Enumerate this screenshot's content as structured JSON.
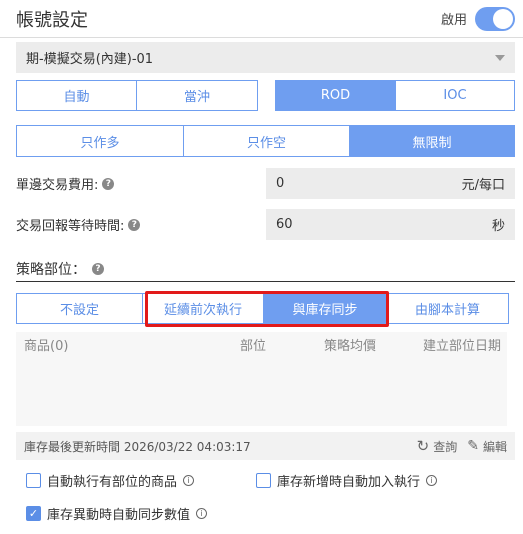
{
  "header": {
    "title": "帳號設定",
    "enable_label": "啟用",
    "enabled": true
  },
  "account": {
    "selected": "期-模擬交易(內建)-01"
  },
  "order_mode": {
    "group1": [
      {
        "label": "自動",
        "active": false
      },
      {
        "label": "當沖",
        "active": false
      }
    ],
    "group2": [
      {
        "label": "ROD",
        "active": true
      },
      {
        "label": "IOC",
        "active": false
      }
    ]
  },
  "direction": [
    {
      "label": "只作多",
      "active": false
    },
    {
      "label": "只作空",
      "active": false
    },
    {
      "label": "無限制",
      "active": true
    }
  ],
  "fee": {
    "label": "單邊交易費用:",
    "value": "0",
    "unit": "元/每口"
  },
  "wait": {
    "label": "交易回報等待時間:",
    "value": "60",
    "unit": "秒"
  },
  "strategy": {
    "title": "策略部位：",
    "tabs": [
      {
        "label": "不設定",
        "active": false
      },
      {
        "label": "延續前次執行",
        "active": false
      },
      {
        "label": "與庫存同步",
        "active": true
      },
      {
        "label": "由腳本計算",
        "active": false
      }
    ]
  },
  "table": {
    "columns": [
      "商品(0)",
      "部位",
      "策略均價",
      "建立部位日期"
    ],
    "rows": []
  },
  "footer": {
    "updated": "庫存最後更新時間 2026/03/22 04:03:17",
    "query": "查詢",
    "edit": "編輯"
  },
  "options": [
    {
      "label": "自動執行有部位的商品",
      "checked": false
    },
    {
      "label": "庫存新增時自動加入執行",
      "checked": false
    },
    {
      "label": "庫存異動時自動同步數值",
      "checked": true
    }
  ],
  "colors": {
    "accent": "#6f9ef0",
    "highlight": "#e21a1a"
  }
}
